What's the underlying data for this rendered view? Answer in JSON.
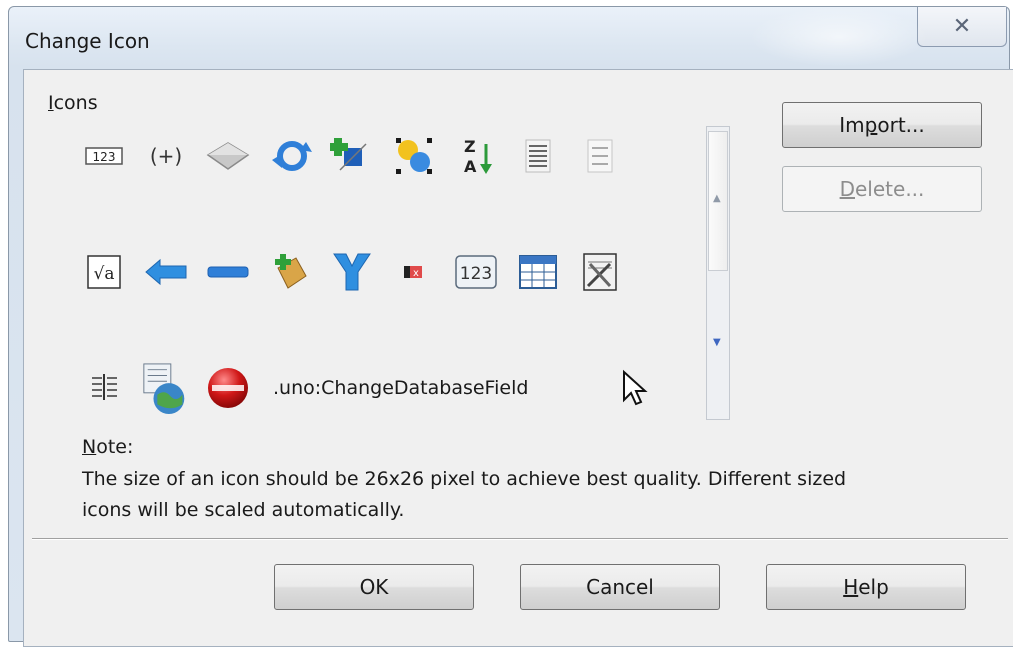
{
  "window": {
    "title": "Change Icon",
    "close_glyph": "✕"
  },
  "icons_group": {
    "label": "Icons",
    "label_mnemonic": "I",
    "label_rest": "cons"
  },
  "icon_grid": {
    "row1": [
      "numbering-icon",
      "bracket-field-icon",
      "diamond-shape-icon",
      "rotate-arrows-icon",
      "crop-add-icon",
      "select-points-icon",
      "sort-za-icon",
      "justify-lines-icon",
      "list-lines-icon"
    ],
    "row2": [
      "formula-sqrt-icon",
      "left-arrow-shape-icon",
      "minus-shape-icon",
      "tag-add-icon",
      "merge-icon",
      "delete-mark-icon",
      "number-format-icon",
      "table-grid-icon",
      "settings-tools-icon"
    ],
    "row3": [
      "columns-icon",
      "database-globe-icon",
      "record-stop-icon",
      "text-command",
      "pointer-icon"
    ],
    "text_item": ".uno:ChangeDatabaseField",
    "badge_123": "123",
    "formula": "√a"
  },
  "buttons": {
    "import_label": "Import...",
    "import_mnemonic_prefix": "Im",
    "import_mnemonic": "p",
    "import_suffix": "ort...",
    "delete_label": "Delete...",
    "delete_mnemonic": "D",
    "delete_suffix": "elete...",
    "ok": "OK",
    "cancel": "Cancel",
    "help_mnemonic": "H",
    "help_suffix": "elp"
  },
  "note": {
    "title_mnemonic": "N",
    "title_rest": "ote:",
    "text": "The size of an icon should be 26x26 pixel to achieve best quality. Different sized icons will be scaled automatically."
  }
}
